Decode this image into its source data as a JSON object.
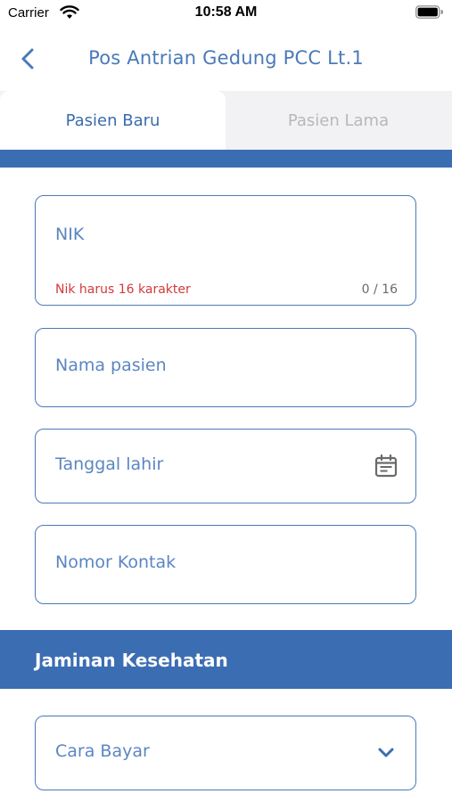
{
  "status_bar": {
    "carrier": "Carrier",
    "time": "10:58 AM"
  },
  "nav": {
    "title": "Pos Antrian Gedung PCC Lt.1",
    "back_icon": "chevron-left-icon"
  },
  "tabs": [
    {
      "label": "Pasien Baru",
      "active": true
    },
    {
      "label": "Pasien Lama",
      "active": false
    }
  ],
  "form": {
    "nik": {
      "placeholder": "NIK",
      "helper": "Nik harus 16 karakter",
      "counter": "0 / 16"
    },
    "nama": {
      "placeholder": "Nama pasien"
    },
    "tanggal": {
      "placeholder": "Tanggal lahir",
      "icon": "calendar-icon"
    },
    "kontak": {
      "placeholder": "Nomor Kontak"
    }
  },
  "section": {
    "title": "Jaminan Kesehatan"
  },
  "cara_bayar": {
    "placeholder": "Cara Bayar",
    "icon": "chevron-down-icon"
  },
  "colors": {
    "primary": "#3b6db3",
    "text_blue": "#4a7ab8",
    "error": "#d33a3a",
    "tab_bg": "#f2f2f4"
  }
}
